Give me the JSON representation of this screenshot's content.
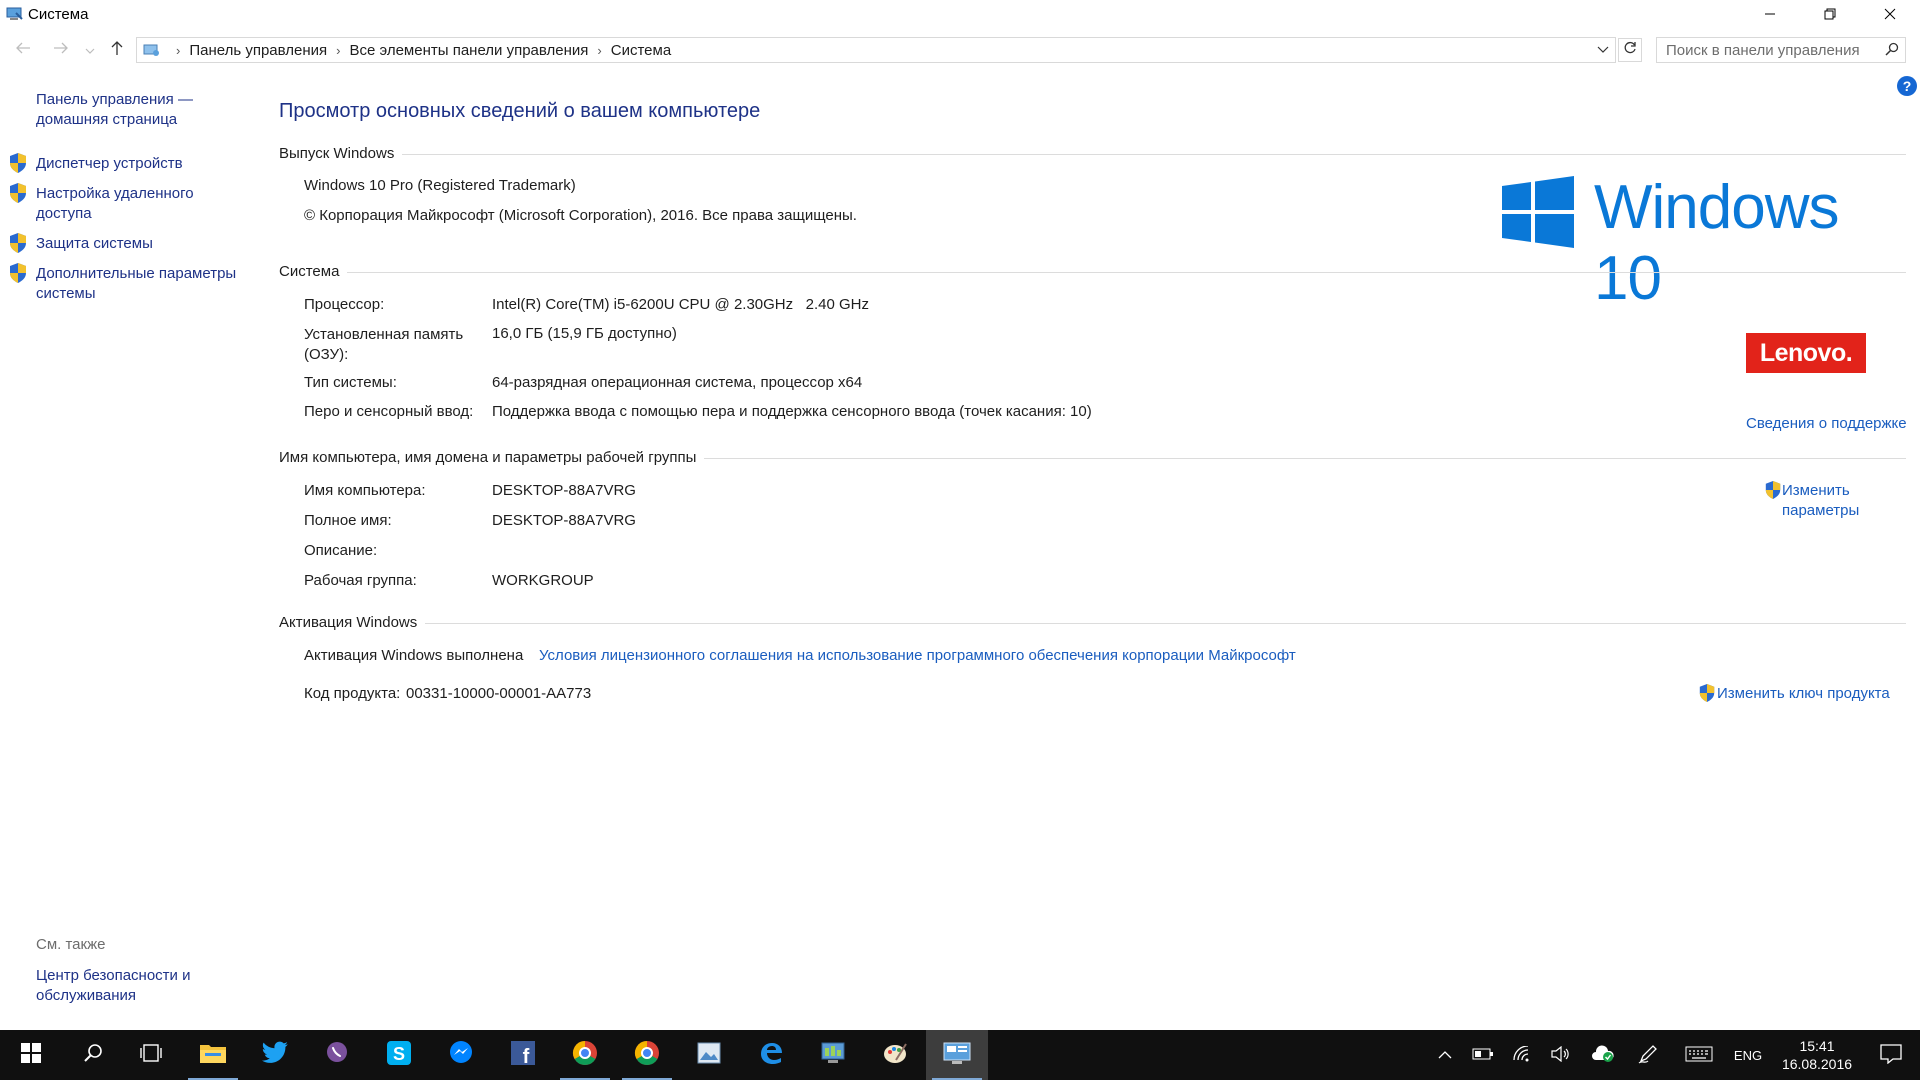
{
  "window": {
    "title": "Система"
  },
  "address": {
    "breadcrumb": [
      "Панель управления",
      "Все элементы панели управления",
      "Система"
    ],
    "search_placeholder": "Поиск в панели управления"
  },
  "sidebar": {
    "home_label": "Панель управления — домашняя страница",
    "items": [
      {
        "label": "Диспетчер устройств"
      },
      {
        "label": "Настройка удаленного доступа"
      },
      {
        "label": "Защита системы"
      },
      {
        "label": "Дополнительные параметры системы"
      }
    ],
    "see_also_label": "См. также",
    "see_also_items": [
      {
        "label": "Центр безопасности и обслуживания"
      }
    ]
  },
  "main": {
    "title": "Просмотр основных сведений о вашем компьютере",
    "edition": {
      "header": "Выпуск Windows",
      "name": "Windows 10 Pro (Registered Trademark)",
      "copyright": "© Корпорация Майкрософт (Microsoft Corporation), 2016. Все права защищены.",
      "logo_text": "Windows 10"
    },
    "system": {
      "header": "Система",
      "rows": [
        {
          "label": "Процессор:",
          "value": "Intel(R) Core(TM) i5-6200U CPU @ 2.30GHz   2.40 GHz"
        },
        {
          "label": "Установленная память (ОЗУ):",
          "value": "16,0 ГБ (15,9 ГБ доступно)"
        },
        {
          "label": "Тип системы:",
          "value": "64-разрядная операционная система, процессор x64"
        },
        {
          "label": "Перо и сенсорный ввод:",
          "value": "Поддержка ввода с помощью пера и поддержка сенсорного ввода (точек касания: 10)"
        }
      ],
      "oem_logo_text": "Lenovo.",
      "support_link": "Сведения о поддержке"
    },
    "computer_name": {
      "header": "Имя компьютера, имя домена и параметры рабочей группы",
      "rows": [
        {
          "label": "Имя компьютера:",
          "value": "DESKTOP-88A7VRG"
        },
        {
          "label": "Полное имя:",
          "value": "DESKTOP-88A7VRG"
        },
        {
          "label": "Описание:",
          "value": ""
        },
        {
          "label": "Рабочая группа:",
          "value": "WORKGROUP"
        }
      ],
      "change_label": "Изменить параметры"
    },
    "activation": {
      "header": "Активация Windows",
      "status": "Активация Windows выполнена",
      "license_link": "Условия лицензионного соглашения на использование программного обеспечения корпорации Майкрософт",
      "product_key_label": "Код продукта:",
      "product_key_value": "00331-10000-00001-AA773",
      "change_key_label": "Изменить ключ продукта"
    }
  },
  "taskbar": {
    "language": "ENG",
    "time": "15:41",
    "date": "16.08.2016"
  },
  "colors": {
    "link": "#1a5dbf",
    "heading": "#1e3287",
    "windows_blue": "#0a78d7",
    "lenovo_red": "#e2231a",
    "taskbar": "#101010"
  }
}
